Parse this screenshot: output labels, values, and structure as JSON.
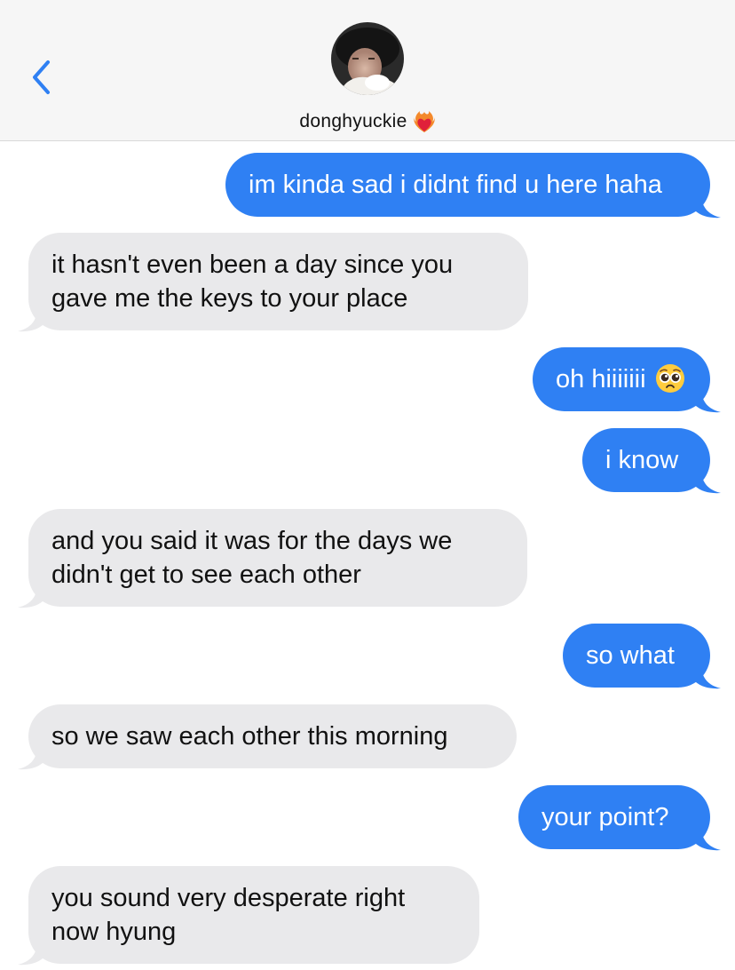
{
  "header": {
    "contact_name": "donghyuckie",
    "back_icon": "chevron-left-icon",
    "name_emoji": "heart-on-fire-emoji",
    "avatar": "contact-avatar-photo"
  },
  "colors": {
    "outgoing_bubble": "#2f80f3",
    "incoming_bubble": "#e9e9eb",
    "accent": "#2f80f3"
  },
  "messages": [
    {
      "direction": "outgoing",
      "text": "im kinda sad i didnt find u here haha"
    },
    {
      "direction": "incoming",
      "text": "it hasn't even been a day since you gave me the keys to your place"
    },
    {
      "direction": "outgoing",
      "text": "oh hiiiiiii",
      "emoji": "pleading-face-emoji"
    },
    {
      "direction": "outgoing",
      "text": "i know"
    },
    {
      "direction": "incoming",
      "text": "and you said it was for the days we didn't get to see each other"
    },
    {
      "direction": "outgoing",
      "text": "so what"
    },
    {
      "direction": "incoming",
      "text": "so we saw each other this morning"
    },
    {
      "direction": "outgoing",
      "text": "your point?"
    },
    {
      "direction": "incoming",
      "text": "you sound very desperate right now hyung"
    }
  ]
}
